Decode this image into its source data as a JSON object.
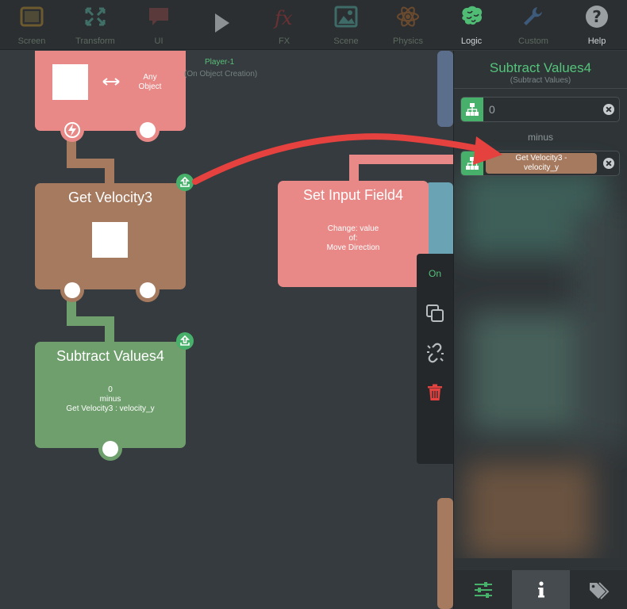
{
  "toolbar": {
    "items": [
      {
        "label": "Screen",
        "icon": "tablet-icon",
        "state": "dim"
      },
      {
        "label": "Transform",
        "icon": "expand-arrows-icon",
        "state": "dim"
      },
      {
        "label": "UI",
        "icon": "speech-bubble-icon",
        "state": "dim"
      },
      {
        "label": "",
        "icon": "play-icon",
        "state": "dim"
      },
      {
        "label": "FX",
        "icon": "fx-icon",
        "state": "dim"
      },
      {
        "label": "Scene",
        "icon": "picture-icon",
        "state": "dim"
      },
      {
        "label": "Physics",
        "icon": "atom-icon",
        "state": "dim"
      },
      {
        "label": "Logic",
        "icon": "brain-icon",
        "state": "active"
      },
      {
        "label": "Custom",
        "icon": "wrench-icon",
        "state": "dim"
      },
      {
        "label": "Help",
        "icon": "help-icon",
        "state": "normal"
      }
    ]
  },
  "canvas": {
    "trigger_block": {
      "any_object": "Any\nObject",
      "object_name": "Player-1",
      "event": "(On Object Creation)"
    },
    "get_velocity": {
      "title": "Get Velocity3"
    },
    "set_input": {
      "title": "Set Input Field4",
      "info": "Change: value\nof:\nMove Direction"
    },
    "subtract": {
      "title": "Subtract Values4",
      "info": "0\nminus\nGet Velocity3 : velocity_y"
    }
  },
  "side_strip": {
    "on_label": "On"
  },
  "inspector": {
    "title": "Subtract Values4",
    "subtitle": "(Subtract Values)",
    "field_1_value": "0",
    "operator": "minus",
    "field_2_chip": "Get Velocity3 -\nvelocity_y"
  },
  "colors": {
    "trigger_block": "#e88987",
    "get_velocity_block": "#a57a5f",
    "set_input_block": "#e88987",
    "subtract_block": "#6e9f6c",
    "accent_green": "#47b06a",
    "arrow_red": "#e5413f"
  }
}
